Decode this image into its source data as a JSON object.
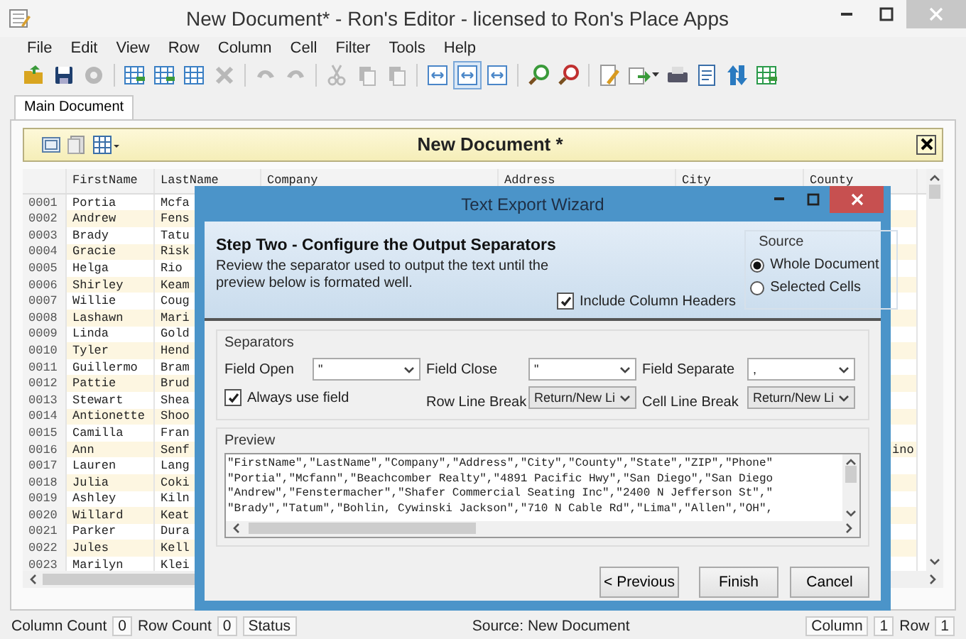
{
  "window": {
    "title": "New Document* - Ron's Editor - licensed to Ron's Place Apps"
  },
  "menu": [
    "File",
    "Edit",
    "View",
    "Row",
    "Column",
    "Cell",
    "Filter",
    "Tools",
    "Help"
  ],
  "toolbar_groups": [
    [
      {
        "kind": "open",
        "disabled": false,
        "selected": false
      },
      {
        "kind": "save",
        "disabled": false,
        "selected": false
      },
      {
        "kind": "gear",
        "disabled": true,
        "selected": false
      }
    ],
    [
      {
        "kind": "addrow",
        "disabled": false,
        "selected": false
      },
      {
        "kind": "addcol",
        "disabled": false,
        "selected": false
      },
      {
        "kind": "grid",
        "disabled": false,
        "selected": false
      },
      {
        "kind": "delete",
        "disabled": true,
        "selected": false
      }
    ],
    [
      {
        "kind": "undo",
        "disabled": true,
        "selected": false
      },
      {
        "kind": "redo",
        "disabled": true,
        "selected": false
      }
    ],
    [
      {
        "kind": "cut",
        "disabled": true,
        "selected": false
      },
      {
        "kind": "copy",
        "disabled": true,
        "selected": false
      },
      {
        "kind": "paste",
        "disabled": true,
        "selected": false
      }
    ],
    [
      {
        "kind": "fitcol",
        "disabled": false,
        "selected": false
      },
      {
        "kind": "fitall",
        "disabled": false,
        "selected": true
      },
      {
        "kind": "expand",
        "disabled": false,
        "selected": false
      }
    ],
    [
      {
        "kind": "zoomin",
        "disabled": false,
        "selected": false
      },
      {
        "kind": "zoomout",
        "disabled": false,
        "selected": false
      }
    ],
    [
      {
        "kind": "edit",
        "disabled": false,
        "selected": false
      },
      {
        "kind": "export",
        "disabled": false,
        "selected": false
      },
      {
        "kind": "printer",
        "disabled": false,
        "selected": false
      },
      {
        "kind": "notes",
        "disabled": false,
        "selected": false
      },
      {
        "kind": "sort",
        "disabled": false,
        "selected": false
      },
      {
        "kind": "sheet",
        "disabled": false,
        "selected": false
      }
    ]
  ],
  "tabs": [
    {
      "label": "Main Document",
      "selected": true
    }
  ],
  "document": {
    "title": "New Document *"
  },
  "grid": {
    "columns": [
      "FirstName",
      "LastName",
      "Company",
      "Address",
      "City",
      "County"
    ],
    "rows": [
      {
        "number": "0001",
        "first_name": "Portia",
        "last_name": "Mcfa"
      },
      {
        "number": "0002",
        "first_name": "Andrew",
        "last_name": "Fens"
      },
      {
        "number": "0003",
        "first_name": "Brady",
        "last_name": "Tatu"
      },
      {
        "number": "0004",
        "first_name": "Gracie",
        "last_name": "Risk"
      },
      {
        "number": "0005",
        "first_name": "Helga",
        "last_name": "Rio"
      },
      {
        "number": "0006",
        "first_name": "Shirley",
        "last_name": "Keam"
      },
      {
        "number": "0007",
        "first_name": "Willie",
        "last_name": "Coug"
      },
      {
        "number": "0008",
        "first_name": "Lashawn",
        "last_name": "Mari"
      },
      {
        "number": "0009",
        "first_name": "Linda",
        "last_name": "Gold"
      },
      {
        "number": "0010",
        "first_name": "Tyler",
        "last_name": "Hend"
      },
      {
        "number": "0011",
        "first_name": "Guillermo",
        "last_name": "Bram"
      },
      {
        "number": "0012",
        "first_name": "Pattie",
        "last_name": "Brud"
      },
      {
        "number": "0013",
        "first_name": "Stewart",
        "last_name": "Shea"
      },
      {
        "number": "0014",
        "first_name": "Antionette",
        "last_name": "Shoo"
      },
      {
        "number": "0015",
        "first_name": "Camilla",
        "last_name": "Fran"
      },
      {
        "number": "0016",
        "first_name": "Ann",
        "last_name": "Senf",
        "county": "ino"
      },
      {
        "number": "0017",
        "first_name": "Lauren",
        "last_name": "Lang"
      },
      {
        "number": "0018",
        "first_name": "Julia",
        "last_name": "Coki"
      },
      {
        "number": "0019",
        "first_name": "Ashley",
        "last_name": "Kiln"
      },
      {
        "number": "0020",
        "first_name": "Willard",
        "last_name": "Keat"
      },
      {
        "number": "0021",
        "first_name": "Parker",
        "last_name": "Dura"
      },
      {
        "number": "0022",
        "first_name": "Jules",
        "last_name": "Kell"
      },
      {
        "number": "0023",
        "first_name": "Marilyn",
        "last_name": "Klei"
      }
    ]
  },
  "dialog": {
    "title": "Text Export Wizard",
    "step_title": "Step Two - Configure the Output Separators",
    "description": "Review the separator used to output the text until the preview below is formated well.",
    "include_headers": {
      "label": "Include Column Headers",
      "checked": true
    },
    "source": {
      "title": "Source",
      "options": [
        {
          "label": "Whole Document",
          "selected": true
        },
        {
          "label": "Selected Cells",
          "selected": false
        }
      ]
    },
    "separators": {
      "title": "Separators",
      "fields": [
        {
          "label": "Field Open",
          "value": "\""
        },
        {
          "label": "Field Close",
          "value": "\""
        },
        {
          "label": "Field Separate",
          "value": ","
        },
        {
          "label": "Row Line Break",
          "value": "Return/New Li"
        },
        {
          "label": "Cell Line Break",
          "value": "Return/New Li"
        }
      ],
      "always_use_field": {
        "label": "Always use field",
        "checked": true
      }
    },
    "preview": {
      "title": "Preview",
      "lines": [
        "\"FirstName\",\"LastName\",\"Company\",\"Address\",\"City\",\"County\",\"State\",\"ZIP\",\"Phone\"",
        "\"Portia\",\"Mcfann\",\"Beachcomber Realty\",\"4891 Pacific Hwy\",\"San Diego\",\"San Diego",
        "\"Andrew\",\"Fenstermacher\",\"Shafer Commercial Seating Inc\",\"2400 N Jefferson St\",\"",
        "\"Brady\",\"Tatum\",\"Bohlin, Cywinski Jackson\",\"710 N Cable Rd\",\"Lima\",\"Allen\",\"OH\","
      ]
    },
    "buttons": [
      "< Previous",
      "Finish",
      "Cancel"
    ]
  },
  "status_bar": {
    "column_count_label": "Column Count",
    "column_count": "0",
    "row_count_label": "Row Count",
    "row_count": "0",
    "status_label": "Status",
    "source": "Source: New Document",
    "column_label": "Column",
    "column": "1",
    "row_label": "Row",
    "row": "1"
  }
}
